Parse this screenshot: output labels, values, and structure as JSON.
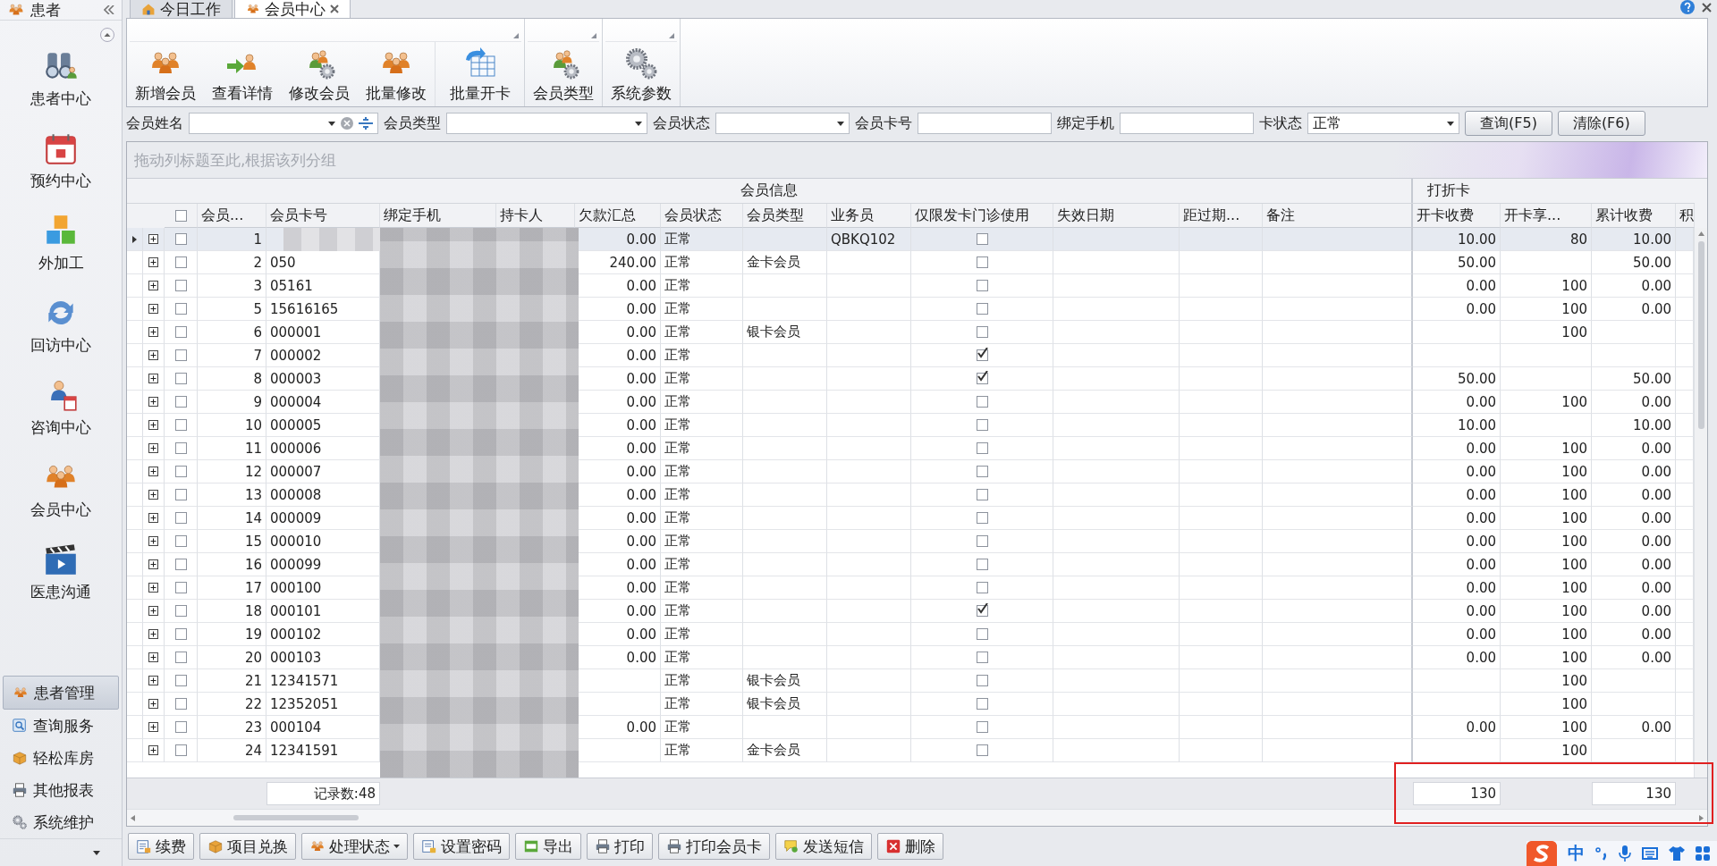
{
  "sidebar": {
    "title": "患者",
    "items": [
      {
        "label": "患者中心",
        "selected": false
      },
      {
        "label": "预约中心",
        "selected": false
      },
      {
        "label": "外加工",
        "selected": false
      },
      {
        "label": "回访中心",
        "selected": false
      },
      {
        "label": "咨询中心",
        "selected": false
      },
      {
        "label": "会员中心",
        "selected": false
      },
      {
        "label": "医患沟通",
        "selected": false
      }
    ],
    "groups": [
      {
        "label": "患者管理",
        "selected": true
      },
      {
        "label": "查询服务",
        "selected": false
      },
      {
        "label": "轻松库房",
        "selected": false
      },
      {
        "label": "其他报表",
        "selected": false
      },
      {
        "label": "系统维护",
        "selected": false
      }
    ]
  },
  "tabs": [
    {
      "label": "今日工作",
      "selected": false
    },
    {
      "label": "会员中心",
      "selected": true
    }
  ],
  "toolbar": {
    "groups": [
      [
        "新增会员",
        "查看详情",
        "修改会员",
        "批量修改",
        "批量开卡"
      ],
      [
        "会员类型"
      ],
      [
        "系统参数"
      ]
    ]
  },
  "filters": [
    {
      "label": "会员姓名",
      "kind": "combo-clear"
    },
    {
      "label": "会员类型",
      "kind": "combo"
    },
    {
      "label": "会员状态",
      "kind": "combo"
    },
    {
      "label": "会员卡号",
      "kind": "text"
    },
    {
      "label": "绑定手机",
      "kind": "text"
    },
    {
      "label": "卡状态",
      "kind": "combo",
      "value": "正常"
    }
  ],
  "filter_buttons": [
    "查询(F5)",
    "清除(F6)"
  ],
  "grid": {
    "group_panel_hint": "拖动列标题至此,根据该列分组",
    "bands": [
      "会员信息",
      "打折卡"
    ],
    "select_all_checked": false,
    "columns": [
      "会员...",
      "会员卡号",
      "绑定手机",
      "持卡人",
      "欠款汇总",
      "会员状态",
      "会员类型",
      "业务员",
      "仅限发卡门诊使用",
      "失效日期",
      "距过期...",
      "备注",
      "开卡收费",
      "开卡享...",
      "累计收费",
      "积"
    ],
    "rows": [
      {
        "selected": true,
        "checked": false,
        "no": "1",
        "debt": "0.00",
        "status": "正常",
        "salesperson": "QBKQ102",
        "restricted": false,
        "fee": "10.00",
        "discount": "80",
        "total": "10.00"
      },
      {
        "selected": false,
        "checked": false,
        "no": "2",
        "card_no": "050",
        "debt": "240.00",
        "status": "正常",
        "type": "金卡会员",
        "restricted": false,
        "fee": "50.00",
        "total": "50.00"
      },
      {
        "selected": false,
        "checked": false,
        "no": "3",
        "card_no": "05161",
        "debt": "0.00",
        "status": "正常",
        "restricted": false,
        "fee": "0.00",
        "discount": "100",
        "total": "0.00"
      },
      {
        "selected": false,
        "checked": false,
        "no": "5",
        "card_no": "15616165",
        "debt": "0.00",
        "status": "正常",
        "restricted": false,
        "fee": "0.00",
        "discount": "100",
        "total": "0.00"
      },
      {
        "selected": false,
        "checked": false,
        "no": "6",
        "card_no": "000001",
        "debt": "0.00",
        "status": "正常",
        "type": "银卡会员",
        "restricted": false,
        "discount": "100"
      },
      {
        "selected": false,
        "checked": false,
        "no": "7",
        "card_no": "000002",
        "debt": "0.00",
        "status": "正常",
        "restricted": true
      },
      {
        "selected": false,
        "checked": false,
        "no": "8",
        "card_no": "000003",
        "debt": "0.00",
        "status": "正常",
        "restricted": true,
        "fee": "50.00",
        "total": "50.00"
      },
      {
        "selected": false,
        "checked": false,
        "no": "9",
        "card_no": "000004",
        "debt": "0.00",
        "status": "正常",
        "restricted": false,
        "fee": "0.00",
        "discount": "100",
        "total": "0.00"
      },
      {
        "selected": false,
        "checked": false,
        "no": "10",
        "card_no": "000005",
        "debt": "0.00",
        "status": "正常",
        "restricted": false,
        "fee": "10.00",
        "total": "10.00"
      },
      {
        "selected": false,
        "checked": false,
        "no": "11",
        "card_no": "000006",
        "debt": "0.00",
        "status": "正常",
        "restricted": false,
        "fee": "0.00",
        "discount": "100",
        "total": "0.00"
      },
      {
        "selected": false,
        "checked": false,
        "no": "12",
        "card_no": "000007",
        "debt": "0.00",
        "status": "正常",
        "restricted": false,
        "fee": "0.00",
        "discount": "100",
        "total": "0.00"
      },
      {
        "selected": false,
        "checked": false,
        "no": "13",
        "card_no": "000008",
        "debt": "0.00",
        "status": "正常",
        "restricted": false,
        "fee": "0.00",
        "discount": "100",
        "total": "0.00"
      },
      {
        "selected": false,
        "checked": false,
        "no": "14",
        "card_no": "000009",
        "debt": "0.00",
        "status": "正常",
        "restricted": false,
        "fee": "0.00",
        "discount": "100",
        "total": "0.00"
      },
      {
        "selected": false,
        "checked": false,
        "no": "15",
        "card_no": "000010",
        "debt": "0.00",
        "status": "正常",
        "restricted": false,
        "fee": "0.00",
        "discount": "100",
        "total": "0.00"
      },
      {
        "selected": false,
        "checked": false,
        "no": "16",
        "card_no": "000099",
        "debt": "0.00",
        "status": "正常",
        "restricted": false,
        "fee": "0.00",
        "discount": "100",
        "total": "0.00"
      },
      {
        "selected": false,
        "checked": false,
        "no": "17",
        "card_no": "000100",
        "debt": "0.00",
        "status": "正常",
        "restricted": false,
        "fee": "0.00",
        "discount": "100",
        "total": "0.00"
      },
      {
        "selected": false,
        "checked": false,
        "no": "18",
        "card_no": "000101",
        "debt": "0.00",
        "status": "正常",
        "restricted": true,
        "fee": "0.00",
        "discount": "100",
        "total": "0.00"
      },
      {
        "selected": false,
        "checked": false,
        "no": "19",
        "card_no": "000102",
        "debt": "0.00",
        "status": "正常",
        "restricted": false,
        "fee": "0.00",
        "discount": "100",
        "total": "0.00"
      },
      {
        "selected": false,
        "checked": false,
        "no": "20",
        "card_no": "000103",
        "debt": "0.00",
        "status": "正常",
        "restricted": false,
        "fee": "0.00",
        "discount": "100",
        "total": "0.00"
      },
      {
        "selected": false,
        "checked": false,
        "no": "21",
        "card_no": "12341571",
        "status": "正常",
        "type": "银卡会员",
        "restricted": false,
        "discount": "100"
      },
      {
        "selected": false,
        "checked": false,
        "no": "22",
        "card_no": "12352051",
        "status": "正常",
        "type": "银卡会员",
        "restricted": false,
        "discount": "100"
      },
      {
        "selected": false,
        "checked": false,
        "no": "23",
        "card_no": "000104",
        "debt": "0.00",
        "status": "正常",
        "restricted": false,
        "fee": "0.00",
        "discount": "100",
        "total": "0.00"
      },
      {
        "selected": false,
        "checked": false,
        "no": "24",
        "card_no": "12341591",
        "status": "正常",
        "type": "金卡会员",
        "restricted": false,
        "discount": "100"
      }
    ],
    "footer": {
      "record_count": "记录数:48",
      "fee_total": "130",
      "total_total": "130"
    }
  },
  "bottom_buttons": [
    {
      "label": "续费",
      "dropdown": false
    },
    {
      "label": "项目兑换",
      "dropdown": false
    },
    {
      "label": "处理状态",
      "dropdown": true
    },
    {
      "label": "设置密码",
      "dropdown": false
    },
    {
      "label": "导出",
      "dropdown": false
    },
    {
      "label": "打印",
      "dropdown": false
    },
    {
      "label": "打印会员卡",
      "dropdown": false
    },
    {
      "label": "发送短信",
      "dropdown": false
    },
    {
      "label": "删除",
      "dropdown": false
    }
  ],
  "ime_bar": {
    "mode": "中"
  }
}
